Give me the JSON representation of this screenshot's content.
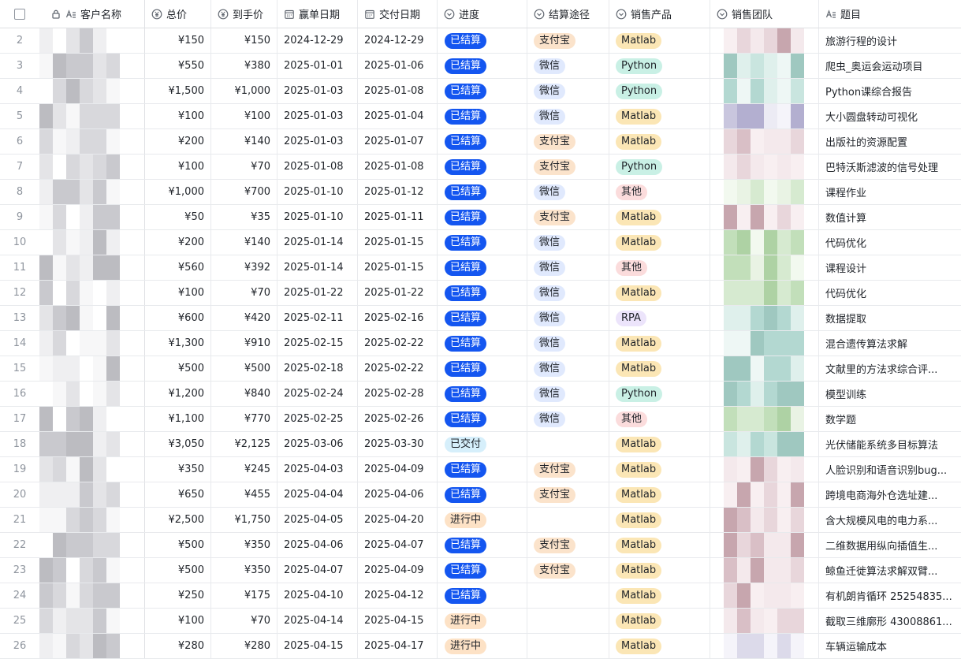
{
  "columns": {
    "name": "客户名称",
    "total": "总价",
    "net": "到手价",
    "win_date": "赢单日期",
    "delivery_date": "交付日期",
    "progress": "进度",
    "payment": "结算途径",
    "product": "销售产品",
    "team": "销售团队",
    "topic": "题目"
  },
  "icons": {
    "checkbox": "select-all-checkbox",
    "lock": "lock-icon",
    "text_field": "text-field-icon",
    "currency": "currency-icon",
    "date": "calendar-icon",
    "select": "single-select-icon"
  },
  "colors": {
    "settled": "#1456f0",
    "delivered": "#d6effb",
    "in_progress": "#fde2c6",
    "alipay": "#fbe3cb",
    "wechat": "#e0e9fd",
    "matlab": "#fbe6b5",
    "python": "#c9f0e5",
    "other": "#fbdcdc",
    "rpa": "#ece4fb"
  },
  "rows": [
    {
      "idx": "2",
      "total": "¥150",
      "net": "¥150",
      "win": "2024-12-29",
      "del": "2024-12-29",
      "progress": "已结算",
      "pk": "settled",
      "payment": "支付宝",
      "payk": "alipay",
      "product": "Matlab",
      "prk": "matlab",
      "topic": "旅游行程的设计"
    },
    {
      "idx": "3",
      "total": "¥550",
      "net": "¥380",
      "win": "2025-01-01",
      "del": "2025-01-06",
      "progress": "已结算",
      "pk": "settled",
      "payment": "微信",
      "payk": "wechat",
      "product": "Python",
      "prk": "python",
      "topic": "爬虫_奥运会运动项目"
    },
    {
      "idx": "4",
      "total": "¥1,500",
      "net": "¥1,000",
      "win": "2025-01-03",
      "del": "2025-01-08",
      "progress": "已结算",
      "pk": "settled",
      "payment": "微信",
      "payk": "wechat",
      "product": "Python",
      "prk": "python",
      "topic": "Python课综合报告"
    },
    {
      "idx": "5",
      "total": "¥100",
      "net": "¥100",
      "win": "2025-01-03",
      "del": "2025-01-04",
      "progress": "已结算",
      "pk": "settled",
      "payment": "微信",
      "payk": "wechat",
      "product": "Matlab",
      "prk": "matlab",
      "topic": "大小圆盘转动可视化"
    },
    {
      "idx": "6",
      "total": "¥200",
      "net": "¥140",
      "win": "2025-01-03",
      "del": "2025-01-07",
      "progress": "已结算",
      "pk": "settled",
      "payment": "支付宝",
      "payk": "alipay",
      "product": "Matlab",
      "prk": "matlab",
      "topic": "出版社的资源配置"
    },
    {
      "idx": "7",
      "total": "¥100",
      "net": "¥70",
      "win": "2025-01-08",
      "del": "2025-01-08",
      "progress": "已结算",
      "pk": "settled",
      "payment": "支付宝",
      "payk": "alipay",
      "product": "Python",
      "prk": "python",
      "topic": "巴特沃斯滤波的信号处理"
    },
    {
      "idx": "8",
      "total": "¥1,000",
      "net": "¥700",
      "win": "2025-01-10",
      "del": "2025-01-12",
      "progress": "已结算",
      "pk": "settled",
      "payment": "微信",
      "payk": "wechat",
      "product": "其他",
      "prk": "other",
      "topic": "课程作业"
    },
    {
      "idx": "9",
      "total": "¥50",
      "net": "¥35",
      "win": "2025-01-10",
      "del": "2025-01-11",
      "progress": "已结算",
      "pk": "settled",
      "payment": "支付宝",
      "payk": "alipay",
      "product": "Matlab",
      "prk": "matlab",
      "topic": "数值计算"
    },
    {
      "idx": "10",
      "total": "¥200",
      "net": "¥140",
      "win": "2025-01-14",
      "del": "2025-01-15",
      "progress": "已结算",
      "pk": "settled",
      "payment": "微信",
      "payk": "wechat",
      "product": "Matlab",
      "prk": "matlab",
      "topic": "代码优化"
    },
    {
      "idx": "11",
      "total": "¥560",
      "net": "¥392",
      "win": "2025-01-14",
      "del": "2025-01-15",
      "progress": "已结算",
      "pk": "settled",
      "payment": "微信",
      "payk": "wechat",
      "product": "其他",
      "prk": "other",
      "topic": "课程设计"
    },
    {
      "idx": "12",
      "total": "¥100",
      "net": "¥70",
      "win": "2025-01-22",
      "del": "2025-01-22",
      "progress": "已结算",
      "pk": "settled",
      "payment": "微信",
      "payk": "wechat",
      "product": "Matlab",
      "prk": "matlab",
      "topic": "代码优化"
    },
    {
      "idx": "13",
      "total": "¥600",
      "net": "¥420",
      "win": "2025-02-11",
      "del": "2025-02-16",
      "progress": "已结算",
      "pk": "settled",
      "payment": "微信",
      "payk": "wechat",
      "product": "RPA",
      "prk": "rpa",
      "topic": "数据提取"
    },
    {
      "idx": "14",
      "total": "¥1,300",
      "net": "¥910",
      "win": "2025-02-15",
      "del": "2025-02-22",
      "progress": "已结算",
      "pk": "settled",
      "payment": "微信",
      "payk": "wechat",
      "product": "Matlab",
      "prk": "matlab",
      "topic": "混合遗传算法求解"
    },
    {
      "idx": "15",
      "total": "¥500",
      "net": "¥500",
      "win": "2025-02-18",
      "del": "2025-02-22",
      "progress": "已结算",
      "pk": "settled",
      "payment": "微信",
      "payk": "wechat",
      "product": "Matlab",
      "prk": "matlab",
      "topic": "文献里的方法求综合评..."
    },
    {
      "idx": "16",
      "total": "¥1,200",
      "net": "¥840",
      "win": "2025-02-24",
      "del": "2025-02-28",
      "progress": "已结算",
      "pk": "settled",
      "payment": "微信",
      "payk": "wechat",
      "product": "Python",
      "prk": "python",
      "topic": "模型训练"
    },
    {
      "idx": "17",
      "total": "¥1,100",
      "net": "¥770",
      "win": "2025-02-25",
      "del": "2025-02-26",
      "progress": "已结算",
      "pk": "settled",
      "payment": "微信",
      "payk": "wechat",
      "product": "其他",
      "prk": "other",
      "topic": "数学题"
    },
    {
      "idx": "18",
      "total": "¥3,050",
      "net": "¥2,125",
      "win": "2025-03-06",
      "del": "2025-03-30",
      "progress": "已交付",
      "pk": "delivered",
      "payment": "",
      "payk": "",
      "product": "Matlab",
      "prk": "matlab",
      "topic": "光伏储能系统多目标算法"
    },
    {
      "idx": "19",
      "total": "¥350",
      "net": "¥245",
      "win": "2025-04-03",
      "del": "2025-04-09",
      "progress": "已结算",
      "pk": "settled",
      "payment": "支付宝",
      "payk": "alipay",
      "product": "Matlab",
      "prk": "matlab",
      "topic": "人脸识别和语音识别bug..."
    },
    {
      "idx": "20",
      "total": "¥650",
      "net": "¥455",
      "win": "2025-04-04",
      "del": "2025-04-06",
      "progress": "已结算",
      "pk": "settled",
      "payment": "支付宝",
      "payk": "alipay",
      "product": "Matlab",
      "prk": "matlab",
      "topic": "跨境电商海外仓选址建..."
    },
    {
      "idx": "21",
      "total": "¥2,500",
      "net": "¥1,750",
      "win": "2025-04-05",
      "del": "2025-04-20",
      "progress": "进行中",
      "pk": "inprogress",
      "payment": "",
      "payk": "",
      "product": "Matlab",
      "prk": "matlab",
      "topic": "含大规模风电的电力系..."
    },
    {
      "idx": "22",
      "total": "¥500",
      "net": "¥350",
      "win": "2025-04-06",
      "del": "2025-04-07",
      "progress": "已结算",
      "pk": "settled",
      "payment": "支付宝",
      "payk": "alipay",
      "product": "Matlab",
      "prk": "matlab",
      "topic": "二维数据用纵向插值生..."
    },
    {
      "idx": "23",
      "total": "¥500",
      "net": "¥350",
      "win": "2025-04-07",
      "del": "2025-04-09",
      "progress": "已结算",
      "pk": "settled",
      "payment": "支付宝",
      "payk": "alipay",
      "product": "Matlab",
      "prk": "matlab",
      "topic": "鲸鱼迁徙算法求解双臂..."
    },
    {
      "idx": "24",
      "total": "¥250",
      "net": "¥175",
      "win": "2025-04-10",
      "del": "2025-04-12",
      "progress": "已结算",
      "pk": "settled",
      "payment": "",
      "payk": "",
      "product": "Matlab",
      "prk": "matlab",
      "topic": "有机朗肯循环 25254835..."
    },
    {
      "idx": "25",
      "total": "¥100",
      "net": "¥70",
      "win": "2025-04-14",
      "del": "2025-04-15",
      "progress": "进行中",
      "pk": "inprogress",
      "payment": "",
      "payk": "",
      "product": "Matlab",
      "prk": "matlab",
      "topic": "截取三维廓形 43008861..."
    },
    {
      "idx": "26",
      "total": "¥280",
      "net": "¥280",
      "win": "2025-04-15",
      "del": "2025-04-17",
      "progress": "进行中",
      "pk": "inprogress",
      "payment": "",
      "payk": "",
      "product": "Matlab",
      "prk": "matlab",
      "topic": "车辆运输成本"
    }
  ]
}
